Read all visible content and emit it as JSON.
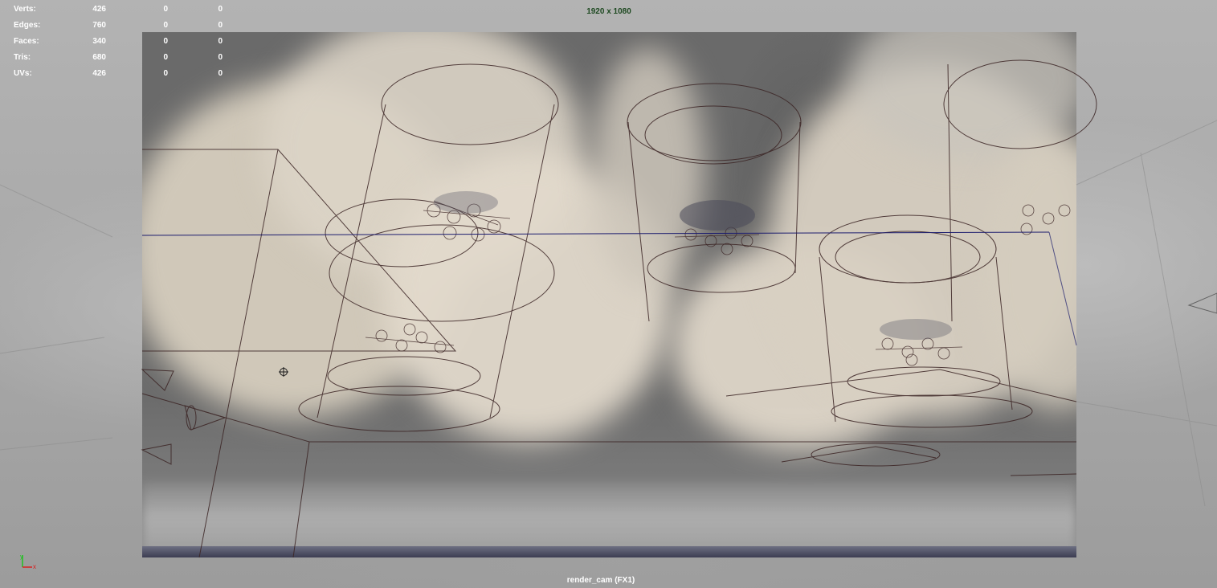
{
  "hud": {
    "stats": [
      {
        "label": "Verts:",
        "values": [
          "426",
          "0",
          "0"
        ]
      },
      {
        "label": "Edges:",
        "values": [
          "760",
          "0",
          "0"
        ]
      },
      {
        "label": "Faces:",
        "values": [
          "340",
          "0",
          "0"
        ]
      },
      {
        "label": "Tris:",
        "values": [
          "680",
          "0",
          "0"
        ]
      },
      {
        "label": "UVs:",
        "values": [
          "426",
          "0",
          "0"
        ]
      }
    ],
    "resolution": "1920 x 1080",
    "camera": "render_cam (FX1)"
  },
  "axis_gizmo": {
    "x_label": "x",
    "y_label": "y",
    "x_color": "#d62020",
    "y_color": "#20c020"
  },
  "colors": {
    "wireframe": "#3b2424",
    "horizon_line": "#1c1c6e",
    "hud_text": "#ffffff",
    "resolution_text": "#1f4a22"
  }
}
